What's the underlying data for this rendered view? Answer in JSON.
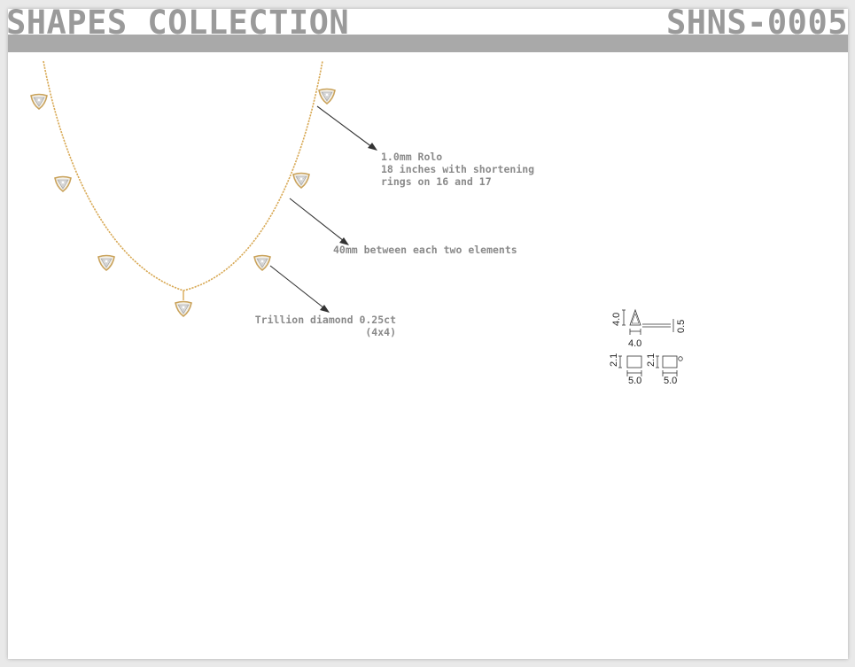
{
  "header": {
    "collection_title": "SHAPES COLLECTION",
    "sku": "SHNS-0005"
  },
  "notes": {
    "chain_line1": "1.0mm Rolo",
    "chain_line2": "18 inches with shortening",
    "chain_line3": "rings on 16 and 17",
    "spacing": "40mm between each two elements",
    "stone_line1": "Trillion diamond 0.25ct",
    "stone_line2": "(4x4)"
  },
  "dimensions": {
    "height": "4.0",
    "width": "4.0",
    "depth": "0.5",
    "bail_height_1": "2.1",
    "bail_width_1": "5.0",
    "bail_height_2": "2.1",
    "bail_width_2": "5.0"
  },
  "colors": {
    "chain_gold": "#d8a955",
    "leader_line": "#333333",
    "header_band": "#a9a9a9",
    "header_text": "#9a9a9a"
  }
}
